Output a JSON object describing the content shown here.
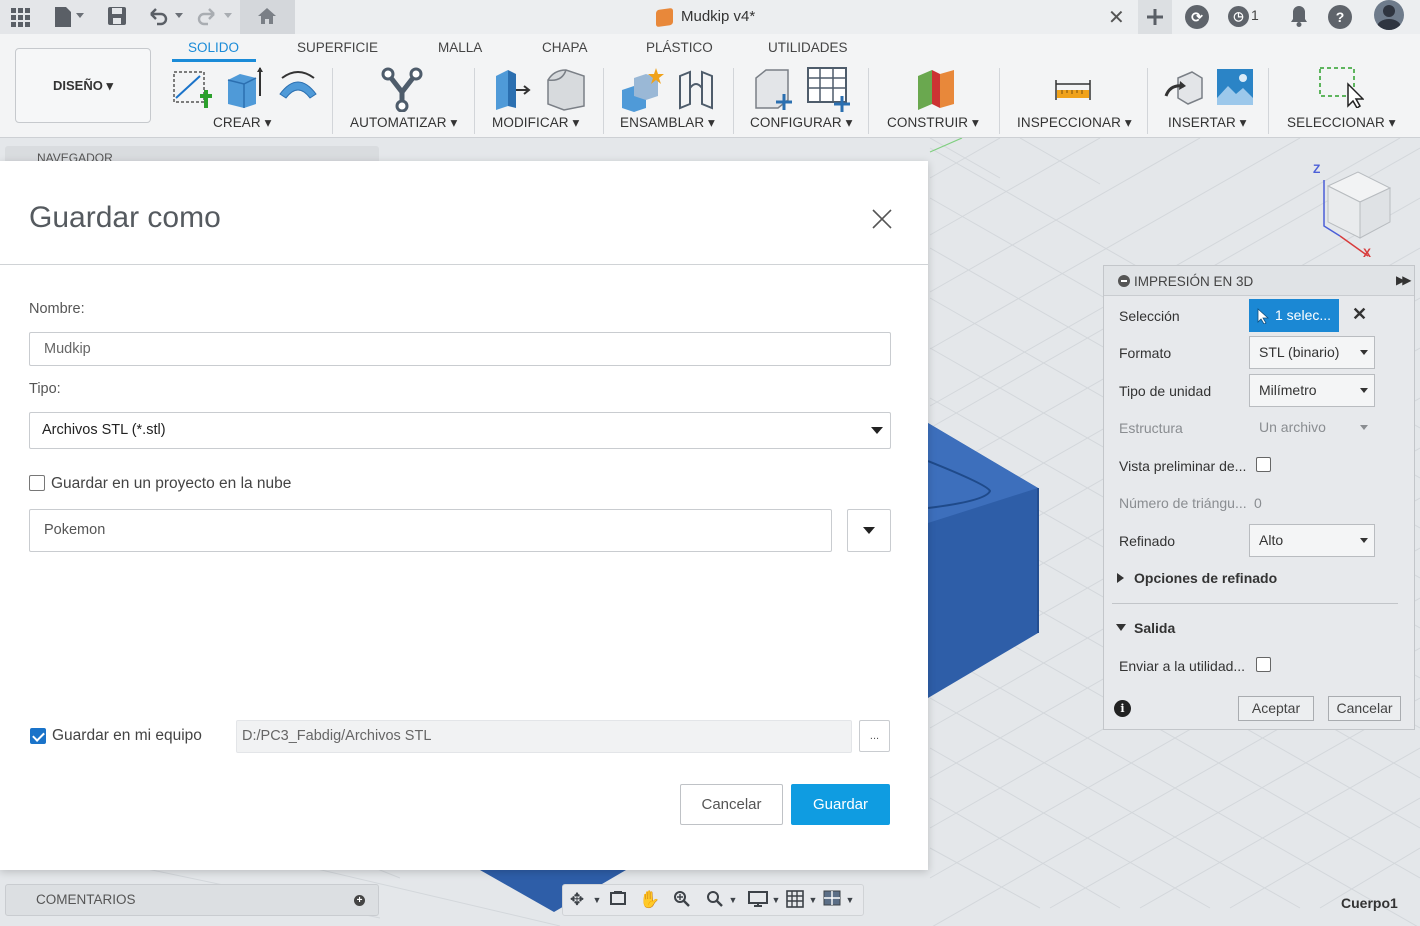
{
  "titlebar": {
    "doc_title": "Mudkip v4*",
    "close_tab": "✕",
    "notifications": "1",
    "icons": [
      "grid-icon",
      "file-icon",
      "save-icon",
      "undo-icon",
      "redo-icon",
      "home-icon",
      "plus-icon",
      "sync-icon",
      "clock-icon",
      "bell-icon",
      "help-icon",
      "avatar"
    ]
  },
  "ribbon": {
    "workspace": "DISEÑO ▾",
    "tabs": [
      "SOLIDO",
      "SUPERFICIE",
      "MALLA",
      "CHAPA",
      "PLÁSTICO",
      "UTILIDADES"
    ],
    "groups": [
      "CREAR ▾",
      "AUTOMATIZAR ▾",
      "MODIFICAR ▾",
      "ENSAMBLAR ▾",
      "CONFIGURAR ▾",
      "CONSTRUIR ▾",
      "INSPECCIONAR ▾",
      "INSERTAR ▾",
      "SELECCIONAR ▾"
    ],
    "accent": "#1a8bd8"
  },
  "navigator": {
    "label": "NAVEGADOR"
  },
  "dialog": {
    "title": "Guardar como",
    "name_label": "Nombre:",
    "name_value": "Mudkip",
    "type_label": "Tipo:",
    "type_value": "Archivos STL (*.stl)",
    "cloud_label": "Guardar en un proyecto en la nube",
    "cloud_checked": false,
    "project_value": "Pokemon",
    "local_label": "Guardar en mi equipo",
    "local_checked": true,
    "path_value": "D:/PC3_Fabdig/Archivos STL",
    "browse": "...",
    "cancel": "Cancelar",
    "save": "Guardar",
    "save_color": "#0f9ce1"
  },
  "print_panel": {
    "title": "IMPRESIÓN EN 3D",
    "selection_label": "Selección",
    "selection_value": "1 selec...",
    "format_label": "Formato",
    "format_value": "STL (binario)",
    "unit_label": "Tipo de unidad",
    "unit_value": "Milímetro",
    "structure_label": "Estructura",
    "structure_value": "Un archivo",
    "preview_label": "Vista preliminar de...",
    "triangles_label": "Número de triángu...",
    "triangles_value": "0",
    "refine_label": "Refinado",
    "refine_value": "Alto",
    "refine_options": "Opciones de refinado",
    "output_section": "Salida",
    "send_label": "Enviar a la utilidad...",
    "accept": "Aceptar",
    "cancel": "Cancelar"
  },
  "bottom": {
    "comments": "COMENTARIOS",
    "body_name": "Cuerpo1"
  },
  "viewcube": {
    "z": "Z",
    "x": "X"
  }
}
